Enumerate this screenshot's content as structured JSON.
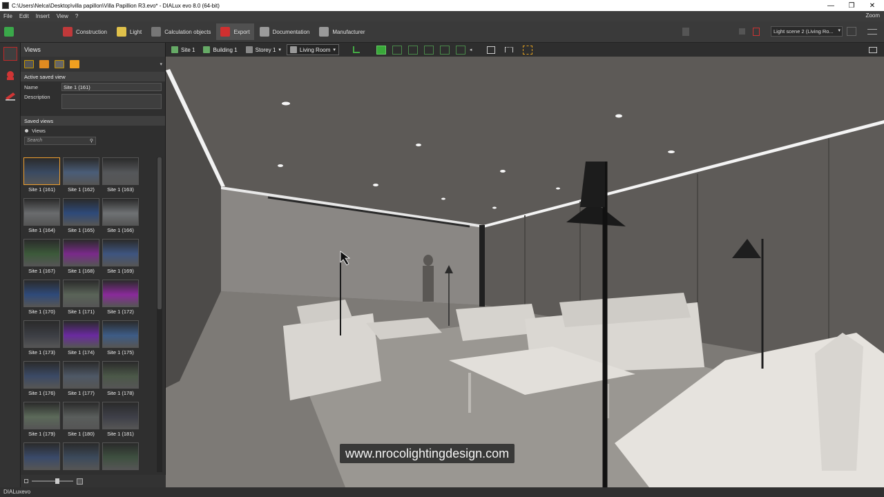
{
  "window": {
    "title": "C:\\Users\\Nelca\\Desktop\\villa papillon\\Villa Papillion R3.evo* - DIALux evo 8.0  (64-bit)",
    "minimize": "—",
    "restore": "❐",
    "close": "✕"
  },
  "menu": {
    "items": [
      "File",
      "Edit",
      "Insert",
      "View",
      "?"
    ],
    "zoom": "Zoom"
  },
  "ribbon": {
    "tabs": [
      {
        "label": "Construction",
        "color": "#c0393a"
      },
      {
        "label": "Light",
        "color": "#e0c14a"
      },
      {
        "label": "Calculation objects",
        "color": "#888888"
      },
      {
        "label": "Export",
        "color": "#d03030"
      },
      {
        "label": "Documentation",
        "color": "#9a9a9a"
      },
      {
        "label": "Manufacturer",
        "color": "#9a9a9a"
      }
    ],
    "active_tab": "Export",
    "light_scene": "Light scene 2 (Living Ro..."
  },
  "panel": {
    "title": "Views",
    "active_saved_view_header": "Active saved view",
    "name_label": "Name",
    "name_value": "Site 1 (161)",
    "description_label": "Description",
    "description_value": "",
    "saved_views_header": "Saved views",
    "views_tab": "Views",
    "search_placeholder": "Search",
    "thumbnails": [
      {
        "label": "Site 1 (161)",
        "tone": "#3a4a62",
        "selected": true
      },
      {
        "label": "Site 1 (162)",
        "tone": "#4a5d78"
      },
      {
        "label": "Site 1 (163)",
        "tone": "#55575a"
      },
      {
        "label": "Site 1 (164)",
        "tone": "#6a6c6e"
      },
      {
        "label": "Site 1 (165)",
        "tone": "#2e4a7a"
      },
      {
        "label": "Site 1 (166)",
        "tone": "#6f7274"
      },
      {
        "label": "Site 1 (167)",
        "tone": "#3c5a3a"
      },
      {
        "label": "Site 1 (168)",
        "tone": "#7a2a8a"
      },
      {
        "label": "Site 1 (169)",
        "tone": "#3e5580"
      },
      {
        "label": "Site 1 (170)",
        "tone": "#2f4a7a"
      },
      {
        "label": "Site 1 (171)",
        "tone": "#5a6458"
      },
      {
        "label": "Site 1 (172)",
        "tone": "#8a2a9a"
      },
      {
        "label": "Site 1 (173)",
        "tone": "#3c3e44"
      },
      {
        "label": "Site 1 (174)",
        "tone": "#6a2aa0"
      },
      {
        "label": "Site 1 (175)",
        "tone": "#3d5c86"
      },
      {
        "label": "Site 1 (176)",
        "tone": "#3b4a66"
      },
      {
        "label": "Site 1 (177)",
        "tone": "#4e5866"
      },
      {
        "label": "Site 1 (178)",
        "tone": "#4b5848"
      },
      {
        "label": "Site 1 (179)",
        "tone": "#5c6a5a"
      },
      {
        "label": "Site 1 (180)",
        "tone": "#5a5e5c"
      },
      {
        "label": "Site 1 (181)",
        "tone": "#3e3f48"
      },
      {
        "label": "",
        "tone": "#3a4a6a"
      },
      {
        "label": "",
        "tone": "#3c4a5c"
      },
      {
        "label": "",
        "tone": "#3e5040"
      }
    ]
  },
  "viewport": {
    "crumbs": [
      "Site 1",
      "Building 1",
      "Storey 1",
      "Living Room"
    ]
  },
  "watermark": "www.nrocolightingdesign.com",
  "status": "DIALuxevo"
}
